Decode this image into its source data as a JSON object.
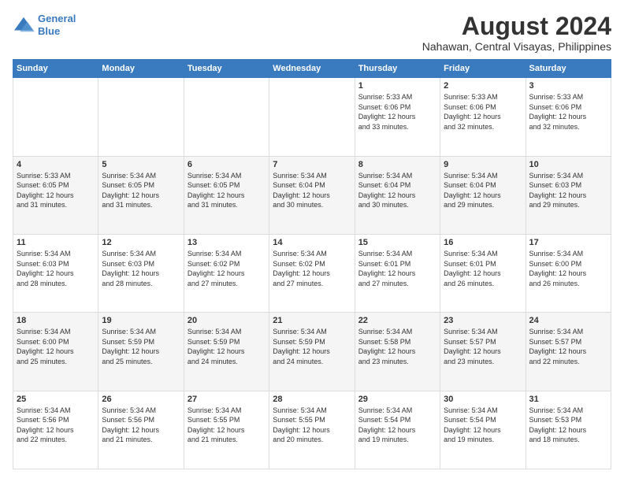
{
  "logo": {
    "line1": "General",
    "line2": "Blue"
  },
  "title": "August 2024",
  "subtitle": "Nahawan, Central Visayas, Philippines",
  "days_of_week": [
    "Sunday",
    "Monday",
    "Tuesday",
    "Wednesday",
    "Thursday",
    "Friday",
    "Saturday"
  ],
  "weeks": [
    [
      {
        "day": "",
        "content": ""
      },
      {
        "day": "",
        "content": ""
      },
      {
        "day": "",
        "content": ""
      },
      {
        "day": "",
        "content": ""
      },
      {
        "day": "1",
        "content": "Sunrise: 5:33 AM\nSunset: 6:06 PM\nDaylight: 12 hours\nand 33 minutes."
      },
      {
        "day": "2",
        "content": "Sunrise: 5:33 AM\nSunset: 6:06 PM\nDaylight: 12 hours\nand 32 minutes."
      },
      {
        "day": "3",
        "content": "Sunrise: 5:33 AM\nSunset: 6:06 PM\nDaylight: 12 hours\nand 32 minutes."
      }
    ],
    [
      {
        "day": "4",
        "content": "Sunrise: 5:33 AM\nSunset: 6:05 PM\nDaylight: 12 hours\nand 31 minutes."
      },
      {
        "day": "5",
        "content": "Sunrise: 5:34 AM\nSunset: 6:05 PM\nDaylight: 12 hours\nand 31 minutes."
      },
      {
        "day": "6",
        "content": "Sunrise: 5:34 AM\nSunset: 6:05 PM\nDaylight: 12 hours\nand 31 minutes."
      },
      {
        "day": "7",
        "content": "Sunrise: 5:34 AM\nSunset: 6:04 PM\nDaylight: 12 hours\nand 30 minutes."
      },
      {
        "day": "8",
        "content": "Sunrise: 5:34 AM\nSunset: 6:04 PM\nDaylight: 12 hours\nand 30 minutes."
      },
      {
        "day": "9",
        "content": "Sunrise: 5:34 AM\nSunset: 6:04 PM\nDaylight: 12 hours\nand 29 minutes."
      },
      {
        "day": "10",
        "content": "Sunrise: 5:34 AM\nSunset: 6:03 PM\nDaylight: 12 hours\nand 29 minutes."
      }
    ],
    [
      {
        "day": "11",
        "content": "Sunrise: 5:34 AM\nSunset: 6:03 PM\nDaylight: 12 hours\nand 28 minutes."
      },
      {
        "day": "12",
        "content": "Sunrise: 5:34 AM\nSunset: 6:03 PM\nDaylight: 12 hours\nand 28 minutes."
      },
      {
        "day": "13",
        "content": "Sunrise: 5:34 AM\nSunset: 6:02 PM\nDaylight: 12 hours\nand 27 minutes."
      },
      {
        "day": "14",
        "content": "Sunrise: 5:34 AM\nSunset: 6:02 PM\nDaylight: 12 hours\nand 27 minutes."
      },
      {
        "day": "15",
        "content": "Sunrise: 5:34 AM\nSunset: 6:01 PM\nDaylight: 12 hours\nand 27 minutes."
      },
      {
        "day": "16",
        "content": "Sunrise: 5:34 AM\nSunset: 6:01 PM\nDaylight: 12 hours\nand 26 minutes."
      },
      {
        "day": "17",
        "content": "Sunrise: 5:34 AM\nSunset: 6:00 PM\nDaylight: 12 hours\nand 26 minutes."
      }
    ],
    [
      {
        "day": "18",
        "content": "Sunrise: 5:34 AM\nSunset: 6:00 PM\nDaylight: 12 hours\nand 25 minutes."
      },
      {
        "day": "19",
        "content": "Sunrise: 5:34 AM\nSunset: 5:59 PM\nDaylight: 12 hours\nand 25 minutes."
      },
      {
        "day": "20",
        "content": "Sunrise: 5:34 AM\nSunset: 5:59 PM\nDaylight: 12 hours\nand 24 minutes."
      },
      {
        "day": "21",
        "content": "Sunrise: 5:34 AM\nSunset: 5:59 PM\nDaylight: 12 hours\nand 24 minutes."
      },
      {
        "day": "22",
        "content": "Sunrise: 5:34 AM\nSunset: 5:58 PM\nDaylight: 12 hours\nand 23 minutes."
      },
      {
        "day": "23",
        "content": "Sunrise: 5:34 AM\nSunset: 5:57 PM\nDaylight: 12 hours\nand 23 minutes."
      },
      {
        "day": "24",
        "content": "Sunrise: 5:34 AM\nSunset: 5:57 PM\nDaylight: 12 hours\nand 22 minutes."
      }
    ],
    [
      {
        "day": "25",
        "content": "Sunrise: 5:34 AM\nSunset: 5:56 PM\nDaylight: 12 hours\nand 22 minutes."
      },
      {
        "day": "26",
        "content": "Sunrise: 5:34 AM\nSunset: 5:56 PM\nDaylight: 12 hours\nand 21 minutes."
      },
      {
        "day": "27",
        "content": "Sunrise: 5:34 AM\nSunset: 5:55 PM\nDaylight: 12 hours\nand 21 minutes."
      },
      {
        "day": "28",
        "content": "Sunrise: 5:34 AM\nSunset: 5:55 PM\nDaylight: 12 hours\nand 20 minutes."
      },
      {
        "day": "29",
        "content": "Sunrise: 5:34 AM\nSunset: 5:54 PM\nDaylight: 12 hours\nand 19 minutes."
      },
      {
        "day": "30",
        "content": "Sunrise: 5:34 AM\nSunset: 5:54 PM\nDaylight: 12 hours\nand 19 minutes."
      },
      {
        "day": "31",
        "content": "Sunrise: 5:34 AM\nSunset: 5:53 PM\nDaylight: 12 hours\nand 18 minutes."
      }
    ]
  ]
}
